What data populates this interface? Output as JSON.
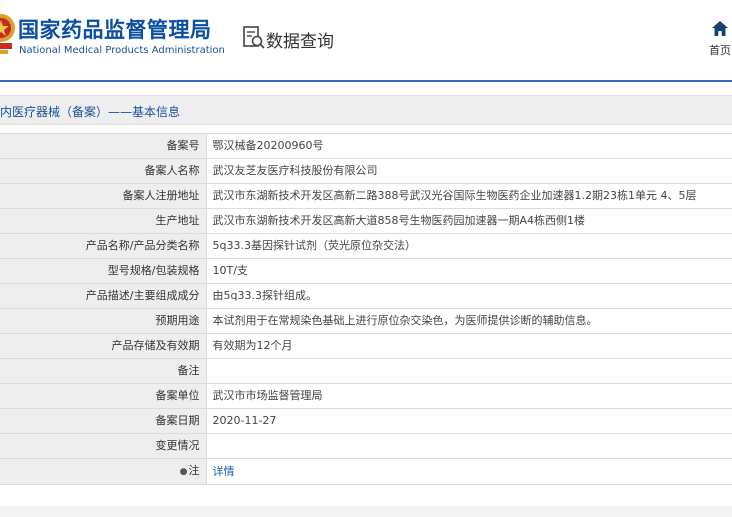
{
  "header": {
    "org_name_cn": "国家药品监督管理局",
    "org_name_en": "National Medical Products Administration",
    "query_label": "数据查询",
    "home_label": "首页",
    "brand_color": "#0b4ea2"
  },
  "section": {
    "title": "内医疗器械（备案）——基本信息"
  },
  "rows": [
    {
      "label": "备案号",
      "value": "鄂汉械备20200960号"
    },
    {
      "label": "备案人名称",
      "value": "武汉友芝友医疗科技股份有限公司"
    },
    {
      "label": "备案人注册地址",
      "value": "武汉市东湖新技术开发区高新二路388号武汉光谷国际生物医药企业加速器1.2期23栋1单元 4、5层"
    },
    {
      "label": "生产地址",
      "value": "武汉市东湖新技术开发区高新大道858号生物医药园加速器一期A4栋西侧1楼"
    },
    {
      "label": "产品名称/产品分类名称",
      "value": "5q33.3基因探针试剂（荧光原位杂交法）"
    },
    {
      "label": "型号规格/包装规格",
      "value": "10T/支"
    },
    {
      "label": "产品描述/主要组成成分",
      "value": "由5q33.3探针组成。"
    },
    {
      "label": "预期用途",
      "value": "本试剂用于在常规染色基础上进行原位杂交染色，为医师提供诊断的辅助信息。"
    },
    {
      "label": "产品存储及有效期",
      "value": "有效期为12个月"
    },
    {
      "label": "备注",
      "value": ""
    },
    {
      "label": "备案单位",
      "value": "武汉市市场监督管理局"
    },
    {
      "label": "备案日期",
      "value": "2020-11-27"
    },
    {
      "label": "变更情况",
      "value": ""
    }
  ],
  "note_row": {
    "label": "注",
    "link_text": "详情"
  }
}
